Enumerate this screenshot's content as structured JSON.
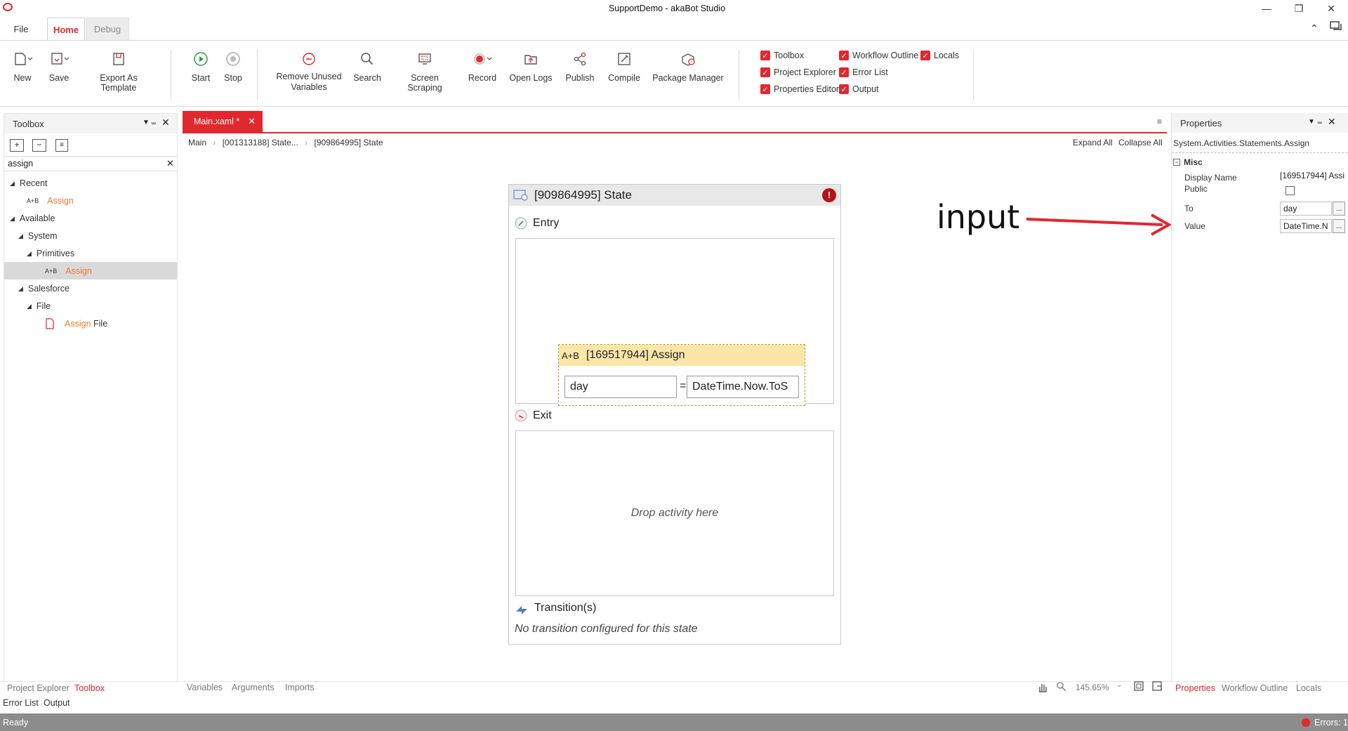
{
  "window": {
    "title": "SupportDemo - akaBot Studio"
  },
  "menu": {
    "file": "File",
    "home": "Home",
    "debug": "Debug"
  },
  "ribbon": {
    "new": "New",
    "save": "Save",
    "export_template": "Export As Template",
    "start": "Start",
    "stop": "Stop",
    "remove_unused_1": "Remove Unused",
    "remove_unused_2": "Variables",
    "search": "Search",
    "screen_scraping": "Screen Scraping",
    "record": "Record",
    "open_logs": "Open Logs",
    "publish": "Publish",
    "compile": "Compile",
    "package_manager": "Package Manager",
    "checks": {
      "toolbox": "Toolbox",
      "project_explorer": "Project Explorer",
      "properties_editor": "Properties Editor",
      "workflow_outline": "Workflow Outline",
      "error_list": "Error List",
      "output": "Output",
      "locals": "Locals"
    }
  },
  "toolbox": {
    "title": "Toolbox",
    "search_value": "assign",
    "recent": "Recent",
    "recent_item": "Assign",
    "available": "Available",
    "system": "System",
    "primitives": "Primitives",
    "primitives_item": "Assign",
    "salesforce": "Salesforce",
    "file": "File",
    "file_item_highlight": "Assign",
    "file_item_rest": " File",
    "assign_icon_text": "A+B"
  },
  "document": {
    "tab_label": "Main.xaml *",
    "breadcrumb": [
      "Main",
      "[001313188] State...",
      "[909864995] State"
    ],
    "expand_all": "Expand All",
    "collapse_all": "Collapse All"
  },
  "state": {
    "title": "[909864995] State",
    "entry": "Entry",
    "exit": "Exit",
    "drop_hint": "Drop activity here",
    "transitions": "Transition(s)",
    "no_transition": "No transition configured for this state",
    "assign": {
      "title": "[169517944] Assign",
      "icon_text": "A+B",
      "to": "day",
      "equals": "=",
      "value": "DateTime.Now.ToS"
    }
  },
  "annotation": {
    "text": "input",
    "color": "#e0282e"
  },
  "properties": {
    "title": "Properties",
    "type": "System.Activities.Statements.Assign",
    "category": "Misc",
    "display_name_label": "Display Name",
    "display_name_value": "[169517944] Assi",
    "public_label": "Public",
    "to_label": "To",
    "to_value": "day",
    "value_label": "Value",
    "value_value": "DateTime.N",
    "dots": "..."
  },
  "bottom_tabs": {
    "left": [
      "Project Explorer",
      "Toolbox"
    ],
    "left2": [
      "Error List",
      "Output"
    ],
    "center": [
      "Variables",
      "Arguments",
      "Imports"
    ],
    "zoom": "145.65%",
    "right": [
      "Properties",
      "Workflow Outline",
      "Locals"
    ]
  },
  "status": {
    "text": "Ready",
    "errors": "Errors: 1"
  },
  "colors": {
    "accent": "#e0282e",
    "assign_header": "#fbe6a8",
    "toolbox_match": "#f07c30"
  }
}
